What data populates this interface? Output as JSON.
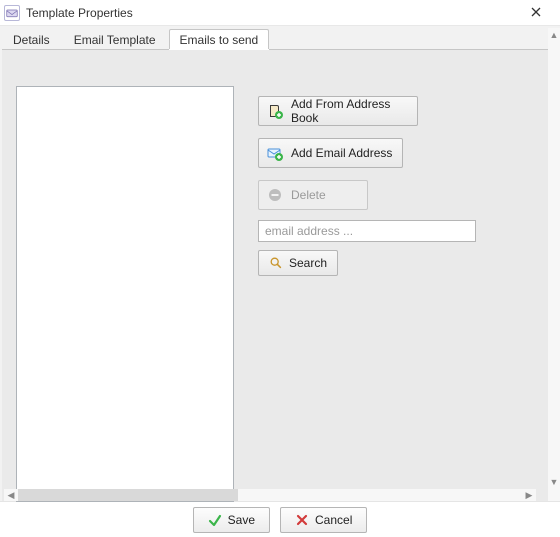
{
  "window": {
    "title": "Template Properties"
  },
  "tabs": {
    "details": "Details",
    "email_template": "Email Template",
    "emails_to_send": "Emails to send",
    "active": "emails_to_send"
  },
  "buttons": {
    "add_from_address_book": "Add From Address Book",
    "add_email_address": "Add Email Address",
    "delete": "Delete",
    "search": "Search",
    "save": "Save",
    "cancel": "Cancel"
  },
  "search": {
    "placeholder": "email address ...",
    "value": ""
  },
  "list": {
    "items": []
  },
  "colors": {
    "panel_bg": "#eaeaea",
    "border": "#b5b5b5",
    "disabled_text": "#9a9a9a"
  }
}
